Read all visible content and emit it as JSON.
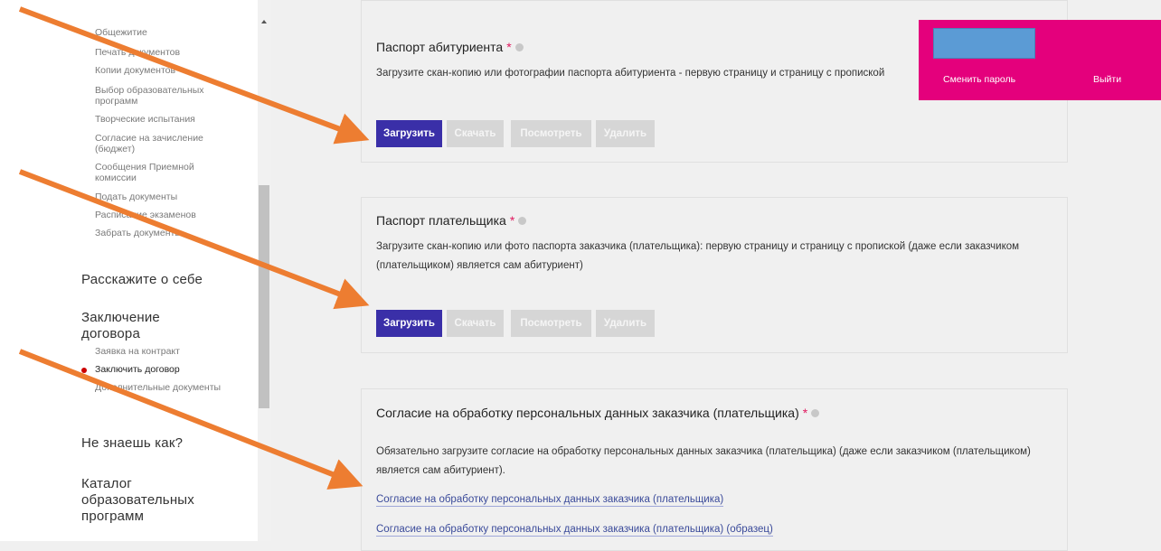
{
  "sidebar": {
    "items": [
      {
        "label": "Общежитие",
        "active": false
      },
      {
        "label": "Печать документов",
        "active": false
      },
      {
        "label": "Копии документов",
        "active": false
      },
      {
        "label": "Выбор образовательных программ",
        "active": false
      },
      {
        "label": "Творческие испытания",
        "active": false
      },
      {
        "label": "Согласие на зачисление (бюджет)",
        "active": false
      },
      {
        "label": "Сообщения Приемной комиссии",
        "active": false
      },
      {
        "label": "Подать документы",
        "active": false
      },
      {
        "label": "Расписание экзаменов",
        "active": false
      },
      {
        "label": "Забрать документы",
        "active": false
      }
    ],
    "about_section": "Расскажите о себе",
    "contract_section": "Заключение договора",
    "contract_items": [
      {
        "label": "Заявка на контракт",
        "active": false
      },
      {
        "label": "Заключить договор",
        "active": true
      },
      {
        "label": "Дополнительные документы",
        "active": false
      }
    ],
    "help_section": "Не знаешь как?",
    "catalog_section": "Каталог образовательных программ"
  },
  "buttons": {
    "upload": "Загрузить",
    "download": "Скачать",
    "view": "Посмотреть",
    "delete": "Удалить"
  },
  "cards": [
    {
      "title": "Паспорт абитуриента",
      "required_mark": "*",
      "description": "Загрузите скан-копию или фотографии паспорта абитуриента - первую страницу и страницу с пропиской"
    },
    {
      "title": "Паспорт плательщика",
      "required_mark": "*",
      "description": "Загрузите скан-копию или фото паспорта заказчика (плательщика): первую страницу и страницу с пропиской (даже если заказчиком (плательщиком) является сам абитуриент)"
    },
    {
      "title": "Согласие на обработку персональных данных заказчика (плательщика)",
      "required_mark": "*",
      "description": "Обязательно загрузите согласие на обработку персональных данных заказчика (плательщика) (даже если заказчиком (плательщиком) является сам абитуриент).",
      "links": [
        "Согласие на обработку персональных данных заказчика (плательщика)",
        "Согласие на обработку персональных данных заказчика (плательщика) (образец)"
      ]
    }
  ],
  "user_panel": {
    "change_password": "Сменить пароль",
    "logout": "Выйти"
  },
  "colors": {
    "primary_button": "#3a2fa8",
    "disabled_button": "#d6d6d6",
    "panel_pink": "#e4007c",
    "redacted_block": "#5b9bd5",
    "annotation_arrow": "#ed7d31",
    "required_star": "#e0195f",
    "active_dot": "#cc0000"
  }
}
